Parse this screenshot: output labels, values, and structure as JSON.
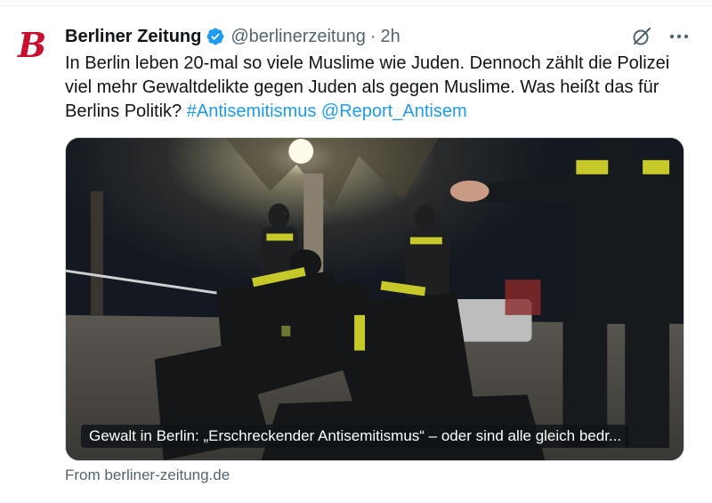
{
  "tweet": {
    "display_name": "Berliner Zeitung",
    "handle": "@berlinerzeitung",
    "separator": "·",
    "time": "2h",
    "text_main": "In Berlin leben 20-mal so viele Muslime wie Juden. Dennoch zählt die Polizei viel mehr Gewaltdelikte gegen Juden als gegen Muslime. Was heißt das für Berlins Politik?",
    "hashtag": "#Antisemitismus",
    "mention": "@Report_Antisem",
    "avatar_letter": "B"
  },
  "card": {
    "title": "Gewalt in Berlin: „Erschreckender Antisemitismus“ – oder sind alle gleich bedr...",
    "source": "From berliner-zeitung.de"
  },
  "icons": {
    "verified": "verified-badge-icon",
    "grok": "grok-icon",
    "more": "more-options-icon"
  },
  "colors": {
    "link": "#1d9bf0",
    "verified": "#1d9bf0",
    "brand_red": "#c8102e",
    "text": "#0f1419",
    "secondary": "#536471"
  }
}
